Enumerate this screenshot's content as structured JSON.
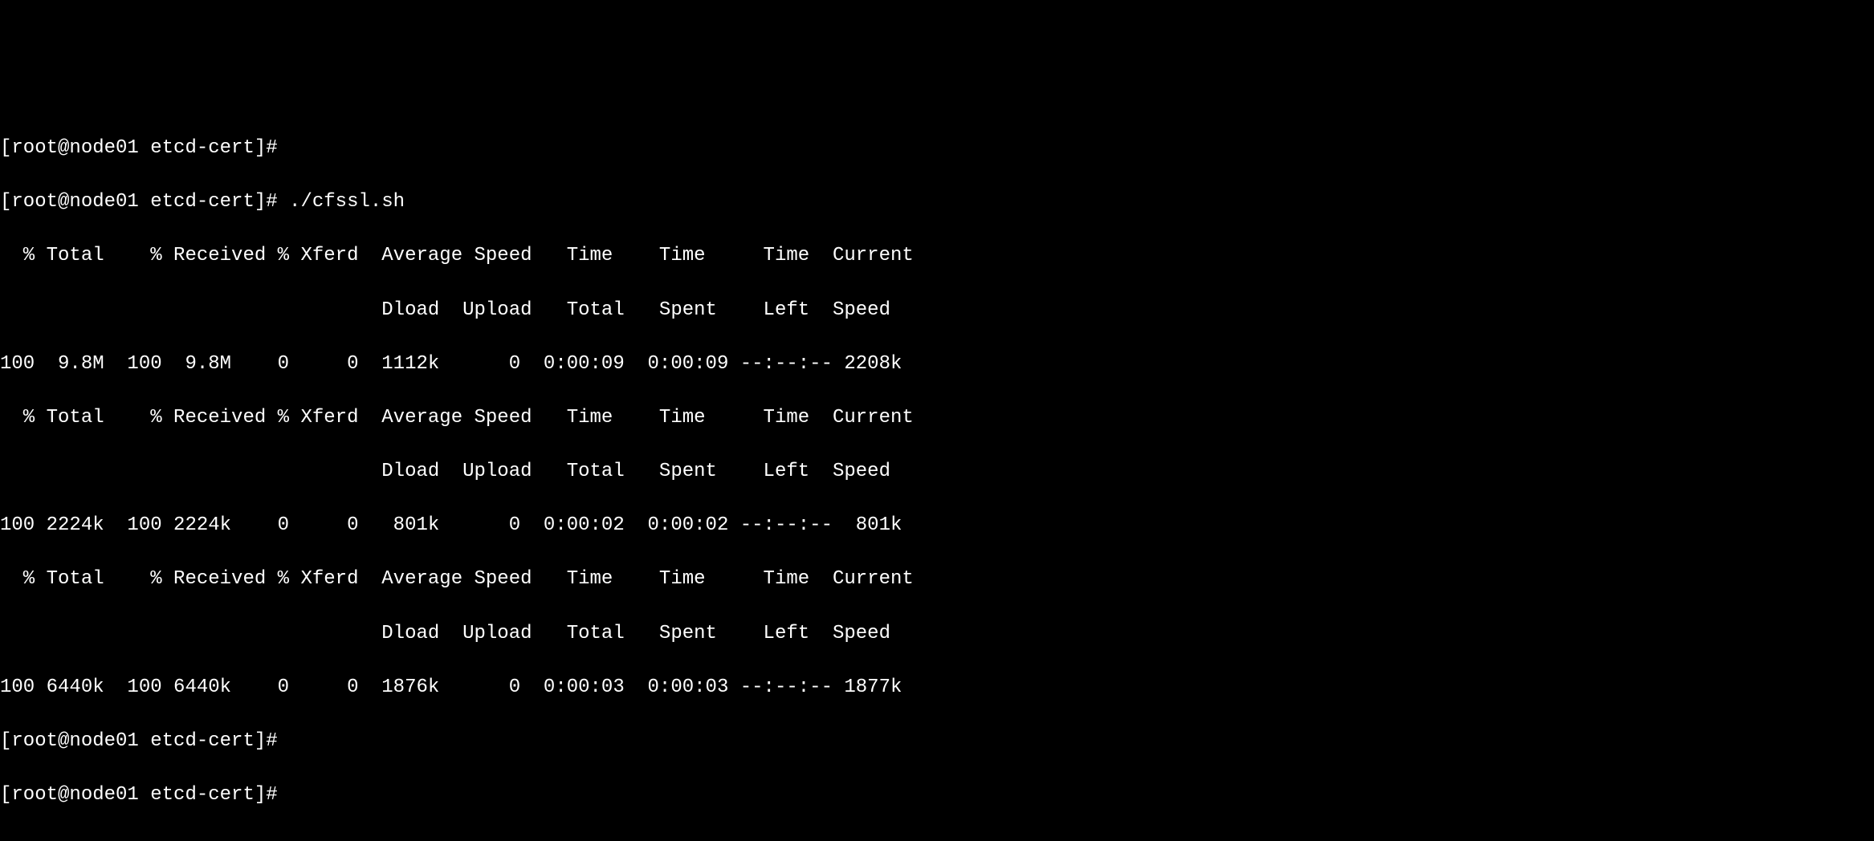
{
  "lines": {
    "l0": "[root@node01 etcd-cert]#",
    "l1": "[root@node01 etcd-cert]# ./cfssl.sh",
    "l2": "  % Total    % Received % Xferd  Average Speed   Time    Time     Time  Current",
    "l3": "                                 Dload  Upload   Total   Spent    Left  Speed",
    "l4": "100  9.8M  100  9.8M    0     0  1112k      0  0:00:09  0:00:09 --:--:-- 2208k",
    "l5": "  % Total    % Received % Xferd  Average Speed   Time    Time     Time  Current",
    "l6": "                                 Dload  Upload   Total   Spent    Left  Speed",
    "l7": "100 2224k  100 2224k    0     0   801k      0  0:00:02  0:00:02 --:--:--  801k",
    "l8": "  % Total    % Received % Xferd  Average Speed   Time    Time     Time  Current",
    "l9": "                                 Dload  Upload   Total   Spent    Left  Speed",
    "l10": "100 6440k  100 6440k    0     0  1876k      0  0:00:03  0:00:03 --:--:-- 1877k",
    "l11": "[root@node01 etcd-cert]#",
    "l12": "[root@node01 etcd-cert]#"
  }
}
